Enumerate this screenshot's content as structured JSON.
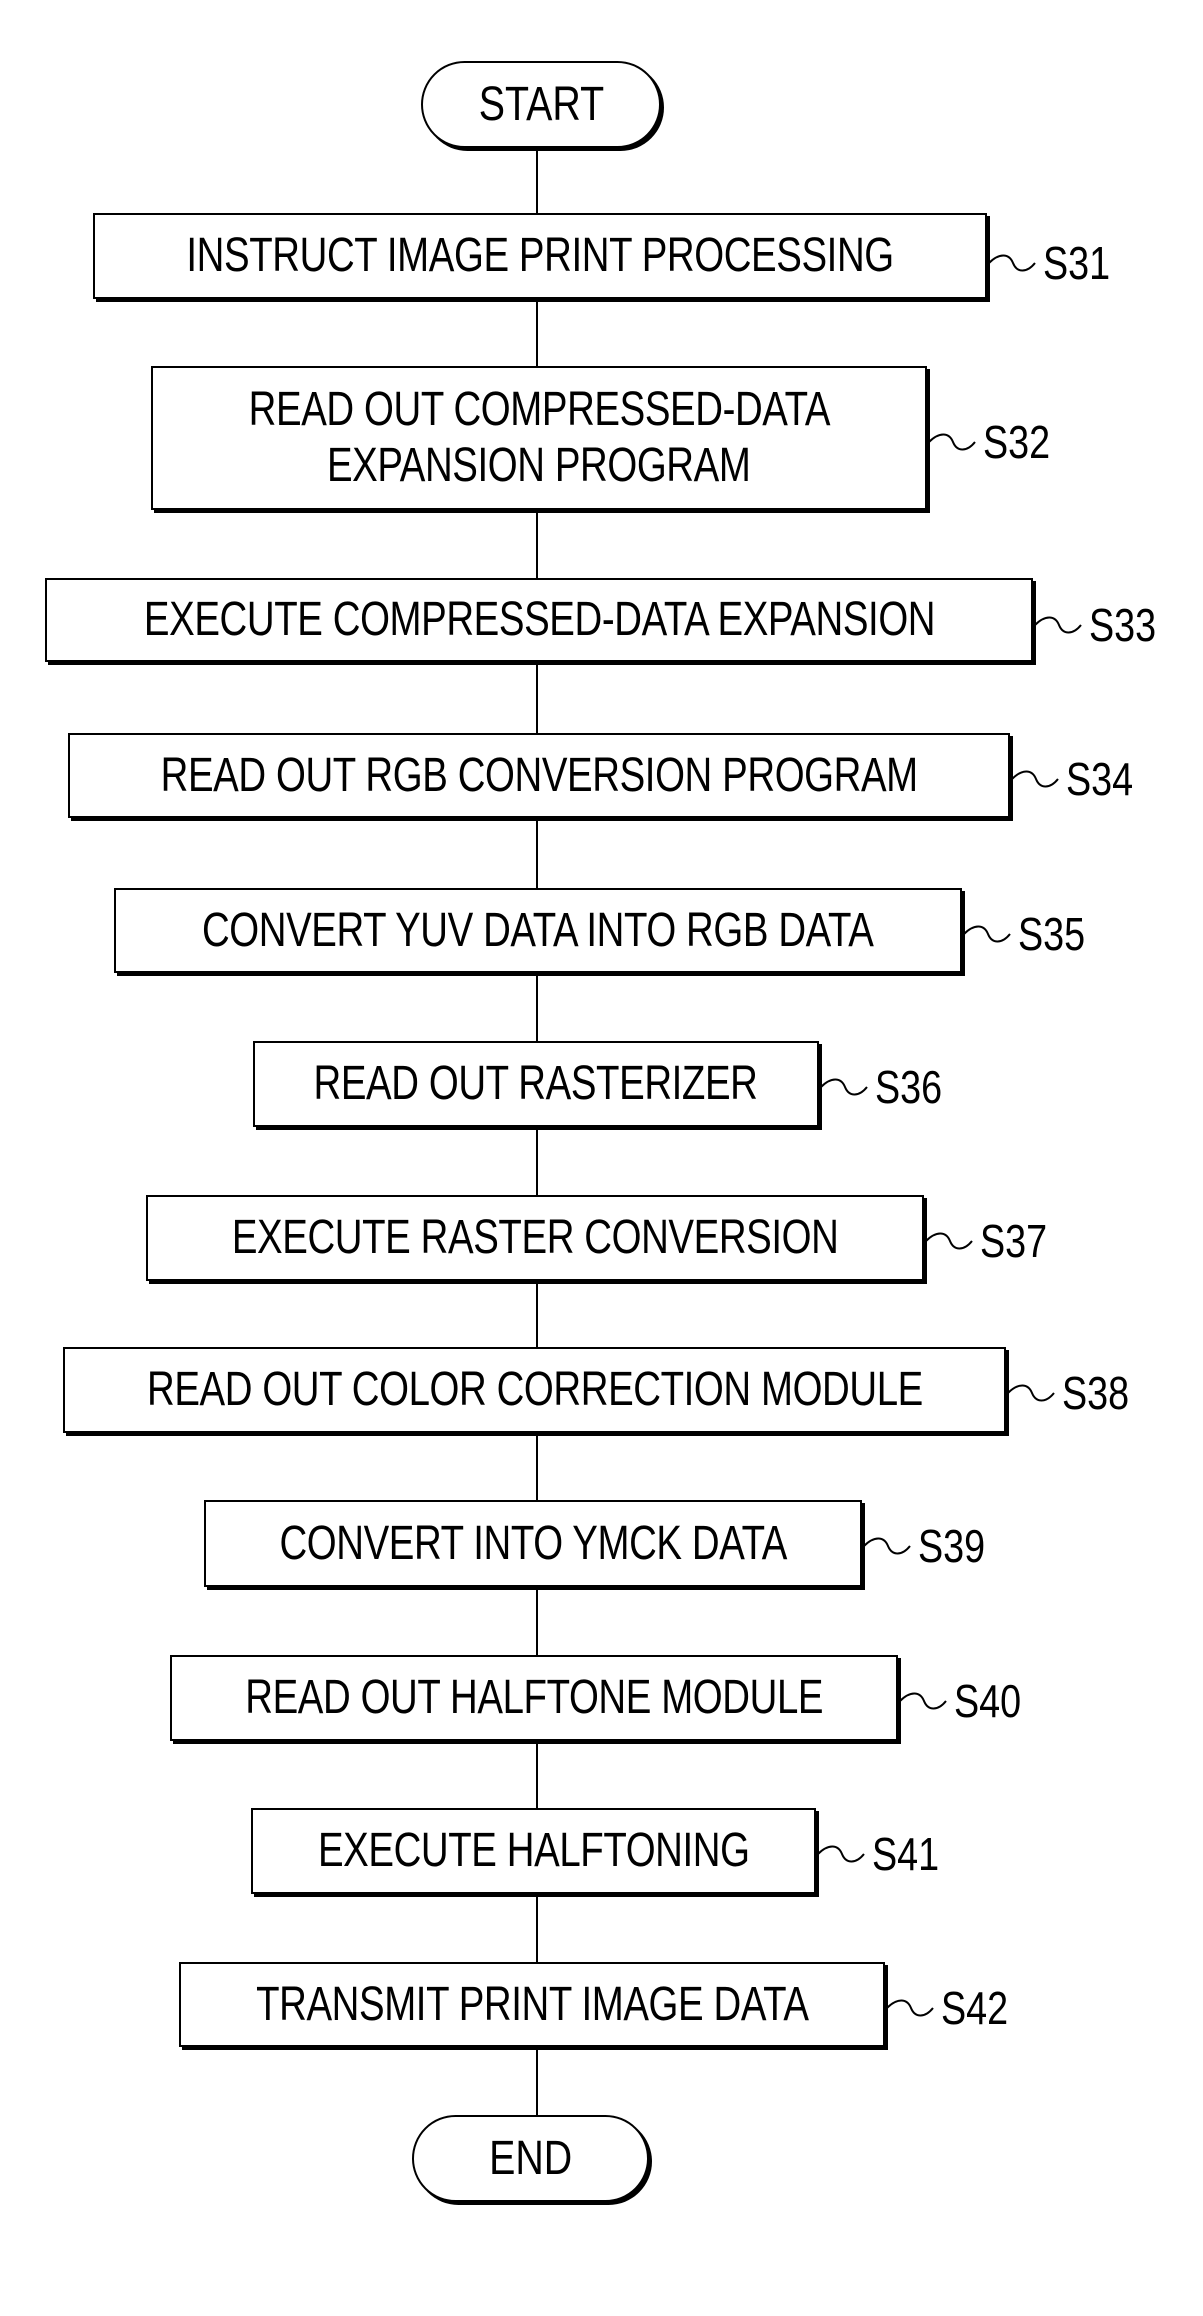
{
  "flowchart": {
    "start": "START",
    "end": "END",
    "steps": [
      {
        "id": "S31",
        "text": "INSTRUCT IMAGE PRINT PROCESSING"
      },
      {
        "id": "S32",
        "text": "READ OUT COMPRESSED-DATA\nEXPANSION PROGRAM",
        "line1": "READ OUT COMPRESSED-DATA",
        "line2": "EXPANSION PROGRAM"
      },
      {
        "id": "S33",
        "text": "EXECUTE COMPRESSED-DATA EXPANSION"
      },
      {
        "id": "S34",
        "text": "READ OUT RGB CONVERSION PROGRAM"
      },
      {
        "id": "S35",
        "text": "CONVERT YUV DATA INTO RGB DATA"
      },
      {
        "id": "S36",
        "text": "READ OUT RASTERIZER"
      },
      {
        "id": "S37",
        "text": "EXECUTE RASTER CONVERSION"
      },
      {
        "id": "S38",
        "text": "READ OUT COLOR CORRECTION MODULE"
      },
      {
        "id": "S39",
        "text": "CONVERT INTO YMCK DATA"
      },
      {
        "id": "S40",
        "text": "READ OUT HALFTONE MODULE"
      },
      {
        "id": "S41",
        "text": "EXECUTE HALFTONING"
      },
      {
        "id": "S42",
        "text": "TRANSMIT PRINT IMAGE DATA"
      }
    ]
  }
}
